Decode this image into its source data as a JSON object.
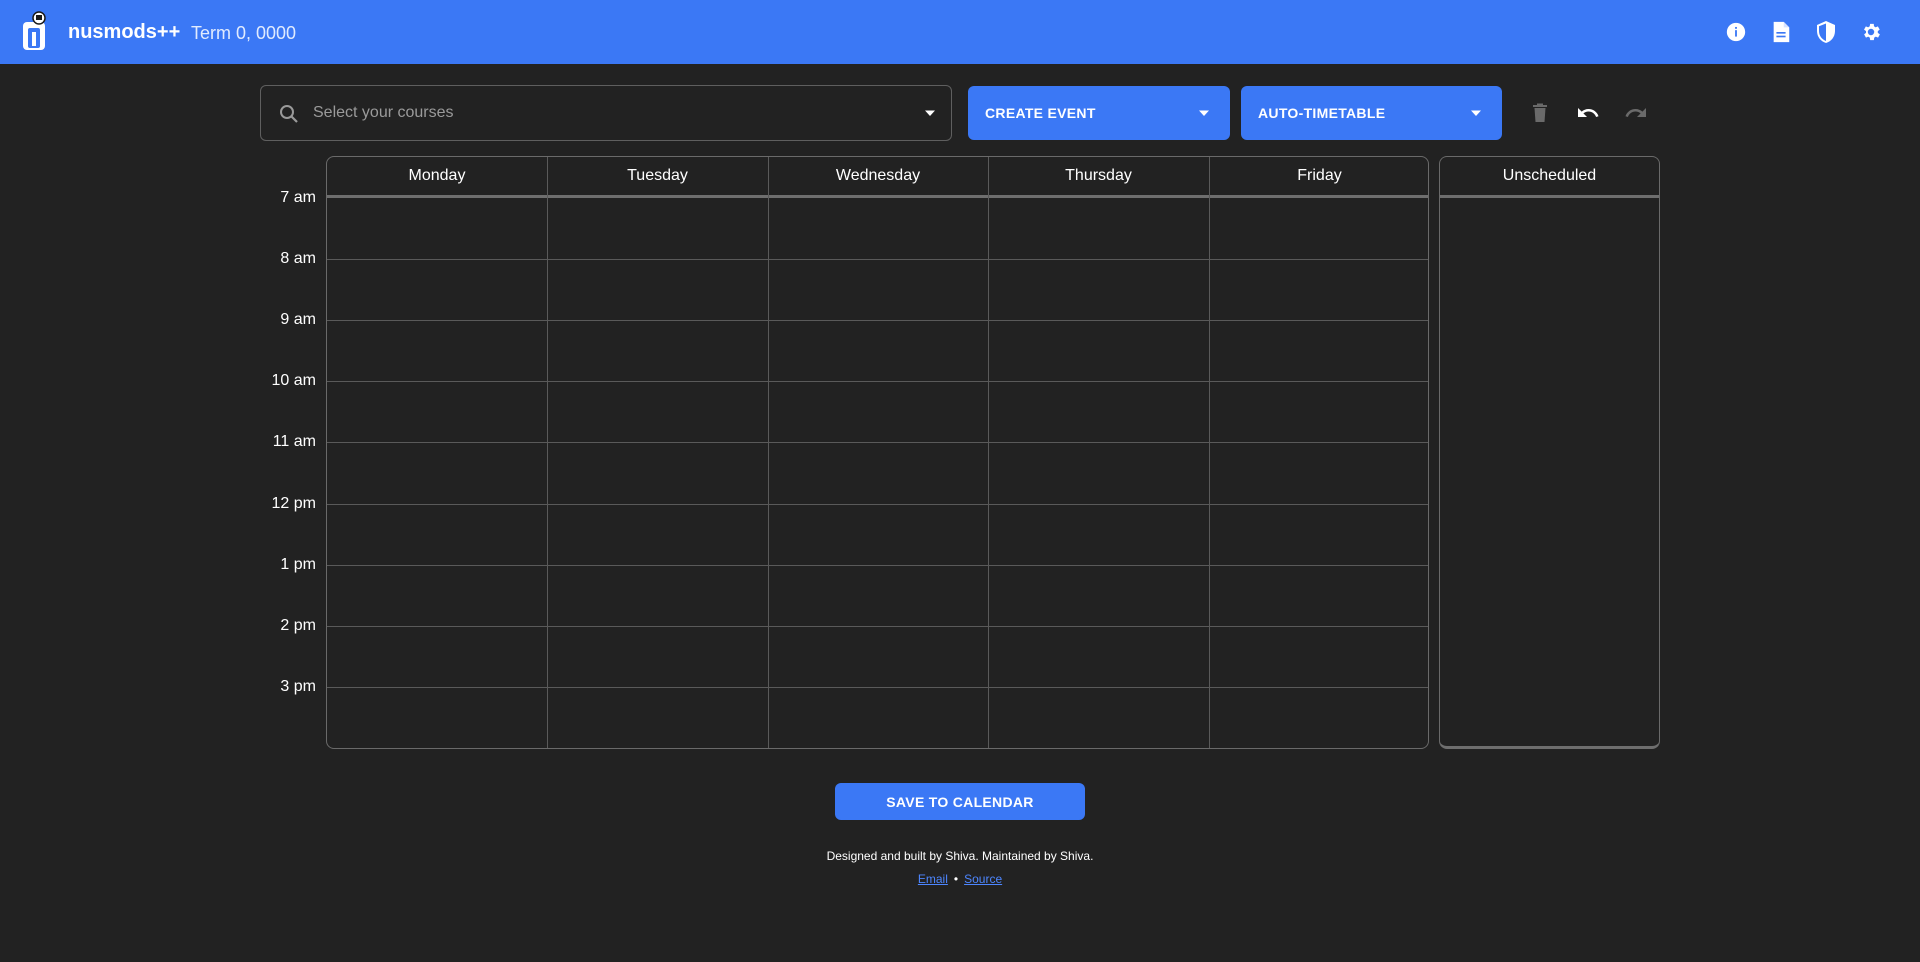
{
  "header": {
    "brand": "nusmods++",
    "term": "Term 0, 0000",
    "icons": [
      "info-icon",
      "document-icon",
      "shield-icon",
      "gear-icon"
    ]
  },
  "toolbar": {
    "search_placeholder": "Select your courses",
    "create_event_label": "CREATE EVENT",
    "auto_timetable_label": "AUTO-TIMETABLE",
    "icons": [
      "trash-icon",
      "undo-icon",
      "redo-icon"
    ]
  },
  "calendar": {
    "days": [
      "Monday",
      "Tuesday",
      "Wednesday",
      "Thursday",
      "Friday"
    ],
    "times": [
      "7 am",
      "8 am",
      "9 am",
      "10 am",
      "11 am",
      "12 pm",
      "1 pm",
      "2 pm",
      "3 pm"
    ],
    "unscheduled_label": "Unscheduled"
  },
  "footer": {
    "save_label": "SAVE TO CALENDAR",
    "credits": "Designed and built by Shiva. Maintained by Shiva.",
    "email_label": "Email",
    "separator": "•",
    "source_label": "Source"
  },
  "colors": {
    "accent": "#3b78f5",
    "background": "#222222",
    "link": "#4d86ff"
  }
}
